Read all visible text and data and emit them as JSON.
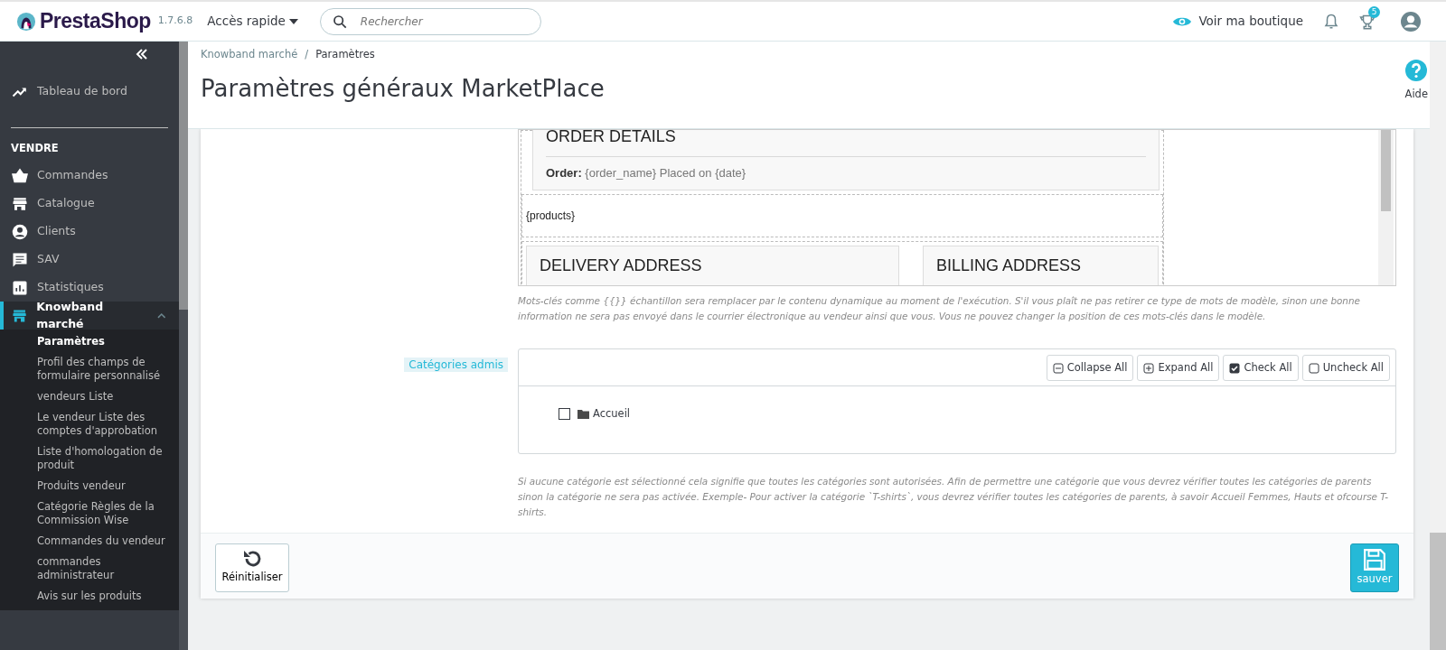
{
  "header": {
    "logo": "PrestaShop",
    "version": "1.7.6.8",
    "quick_access": "Accès rapide",
    "search": {
      "placeholder": "Rechercher"
    },
    "view_shop": "Voir ma boutique",
    "achievements_badge": "5"
  },
  "sidebar": {
    "top_items": [
      {
        "label": "Tableau de bord"
      }
    ],
    "section": "VENDRE",
    "items": [
      {
        "label": "Commandes",
        "selected": false
      },
      {
        "label": "Catalogue",
        "selected": false
      },
      {
        "label": "Clients",
        "selected": false
      },
      {
        "label": "SAV",
        "selected": false
      },
      {
        "label": "Statistiques",
        "selected": false
      },
      {
        "label": "Knowband marché",
        "selected": true,
        "expanded": true,
        "children": [
          {
            "label": "Paramètres",
            "selected": true
          },
          {
            "label": "Profil des champs de formulaire personnalisé",
            "selected": false
          },
          {
            "label": "vendeurs Liste",
            "selected": false
          },
          {
            "label": "Le vendeur Liste des comptes d'approbation",
            "selected": false
          },
          {
            "label": "Liste d'homologation de produit",
            "selected": false
          },
          {
            "label": "Produits vendeur",
            "selected": false
          },
          {
            "label": "Catégorie Règles de la Commission Wise",
            "selected": false
          },
          {
            "label": "Commandes du vendeur",
            "selected": false
          },
          {
            "label": "commandes administrateur",
            "selected": false
          },
          {
            "label": "Avis sur les produits",
            "selected": false
          }
        ]
      }
    ]
  },
  "breadcrumb": {
    "items": [
      "Knowband marché",
      "Paramètres"
    ],
    "separator": "/"
  },
  "title": "Paramètres généraux MarketPlace",
  "help": "Aide",
  "template_preview": {
    "order_heading": "ORDER DETAILS",
    "order_line": "**Order:** {order_name} Placed on {date}",
    "products": "{products}",
    "delivery_heading": "DELIVERY ADDRESS",
    "billing_heading": "BILLING ADDRESS"
  },
  "template_note": "Mots-clés comme {{}} échantillon sera remplacer par le contenu dynamique au moment de l'exécution. S'il vous plaît ne pas retirer ce type de mots de modèle, sinon une bonne information ne sera pas envoyé dans le courrier électronique au vendeur ainsi que vous. Vous ne pouvez changer la position de ces mots-clés dans le modèle.",
  "categories": {
    "label": "Catégories admis",
    "buttons": [
      {
        "label": "Collapse All",
        "kind": "collapse"
      },
      {
        "label": "Expand All",
        "kind": "expand"
      },
      {
        "label": "Check All",
        "kind": "check"
      },
      {
        "label": "Uncheck All",
        "kind": "uncheck"
      }
    ],
    "tree": [
      {
        "label": "Accueil",
        "checked": false
      }
    ],
    "help": "Si aucune catégorie est sélectionné cela signifie que toutes les catégories sont autorisées. Afin de permettre une catégorie que vous devrez vérifier toutes les catégories de parents sinon la catégorie ne sera pas activée. Exemple- Pour activer la catégorie  `T-shirts`, vous devrez vérifier toutes les catégories de parents, à savoir Accueil Femmes, Hauts et ofcourse T-shirts."
  },
  "footer": {
    "reset": "Réinitialiser",
    "save": "sauver"
  }
}
